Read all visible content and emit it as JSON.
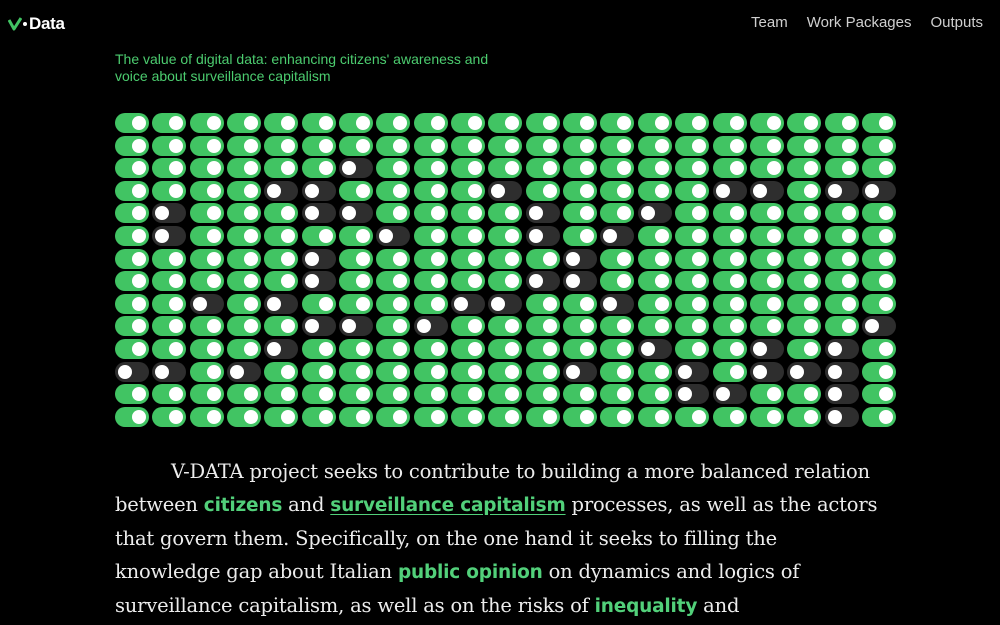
{
  "brand": {
    "name": "Data",
    "accent": "#41c463"
  },
  "nav": {
    "items": [
      "Team",
      "Work Packages",
      "Outputs"
    ]
  },
  "subtitle": "The value of digital data: enhancing citizens' awareness and voice about surveillance capitalism",
  "toggle_grid": {
    "columns": 21,
    "rows": 14,
    "on_color": "#41c463",
    "off_color": "#2e2e2e",
    "off_cells": [
      [
        2,
        6
      ],
      [
        3,
        4
      ],
      [
        3,
        5
      ],
      [
        3,
        10
      ],
      [
        3,
        16
      ],
      [
        3,
        17
      ],
      [
        3,
        19
      ],
      [
        3,
        20
      ],
      [
        4,
        1
      ],
      [
        4,
        5
      ],
      [
        4,
        6
      ],
      [
        4,
        11
      ],
      [
        4,
        14
      ],
      [
        5,
        1
      ],
      [
        5,
        7
      ],
      [
        5,
        11
      ],
      [
        5,
        13
      ],
      [
        6,
        5
      ],
      [
        6,
        12
      ],
      [
        7,
        5
      ],
      [
        7,
        11
      ],
      [
        7,
        12
      ],
      [
        8,
        2
      ],
      [
        8,
        4
      ],
      [
        8,
        9
      ],
      [
        8,
        10
      ],
      [
        8,
        13
      ],
      [
        9,
        5
      ],
      [
        9,
        6
      ],
      [
        9,
        8
      ],
      [
        9,
        20
      ],
      [
        10,
        4
      ],
      [
        10,
        14
      ],
      [
        10,
        17
      ],
      [
        10,
        19
      ],
      [
        11,
        0
      ],
      [
        11,
        1
      ],
      [
        11,
        3
      ],
      [
        11,
        12
      ],
      [
        11,
        15
      ],
      [
        11,
        17
      ],
      [
        11,
        18
      ],
      [
        11,
        19
      ],
      [
        12,
        15
      ],
      [
        12,
        16
      ],
      [
        12,
        19
      ],
      [
        13,
        19
      ]
    ]
  },
  "body": {
    "t1": "V-DATA project seeks to contribute to building a more balanced relation between ",
    "h1": "citizens",
    "t2": " and ",
    "h2": "surveillance capitalism",
    "t3": " processes, as well as the actors that govern them. Specifically, on the one hand it seeks to filling the knowledge gap about Italian ",
    "h3": "public opinion",
    "t4": " on dynamics and logics of surveillance capitalism, as well as on the risks of ",
    "h4": "inequality",
    "t5": " and"
  }
}
